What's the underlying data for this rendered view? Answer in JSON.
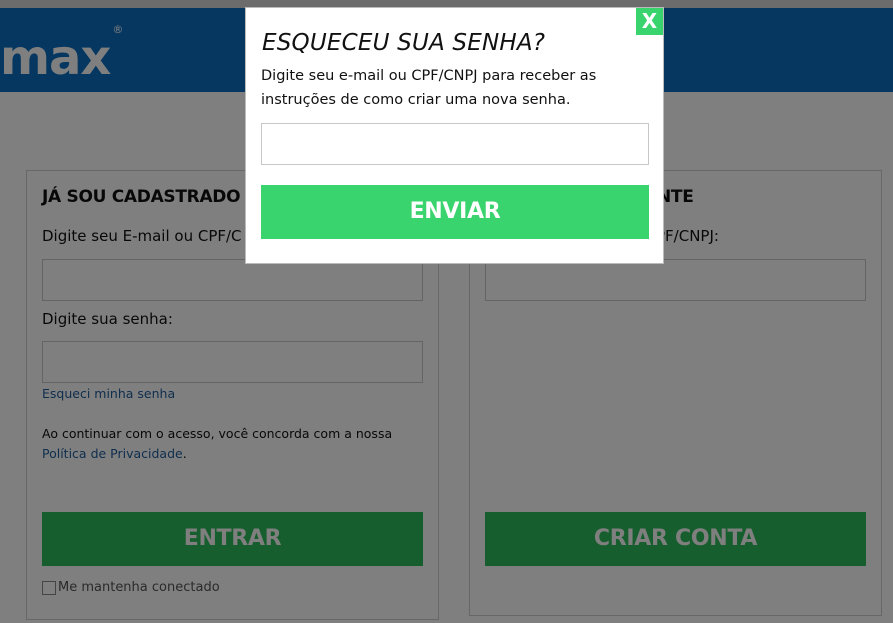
{
  "header": {
    "logo_text": "max",
    "logo_mark": "®"
  },
  "login_panel": {
    "title": "JÁ SOU CADASTRADO",
    "email_label": "Digite seu E-mail ou CPF/C",
    "password_label": "Digite sua senha:",
    "forgot_link": "Esqueci minha senha",
    "consent_text": "Ao continuar com o acesso, você concorda com a nossa",
    "privacy_link": "Política de Privacidade",
    "privacy_suffix": ".",
    "submit_label": "ENTRAR",
    "remember_label": "Me mantenha conectado"
  },
  "register_panel": {
    "title_partial": "NTE",
    "id_label_partial": "PF/CNPJ:",
    "submit_label": "CRIAR CONTA"
  },
  "modal": {
    "close_label": "X",
    "title": "ESQUECEU SUA SENHA?",
    "description_line1": "Digite seu e-mail ou CPF/CNPJ para receber as",
    "description_line2": "instruções de como criar uma nova senha.",
    "input_value": "",
    "submit_label": "ENVIAR"
  },
  "colors": {
    "header_blue": "#0a6fc2",
    "green_button": "#2dbd5a",
    "modal_green": "#3ad46e",
    "link_blue": "#1f5d9c"
  }
}
